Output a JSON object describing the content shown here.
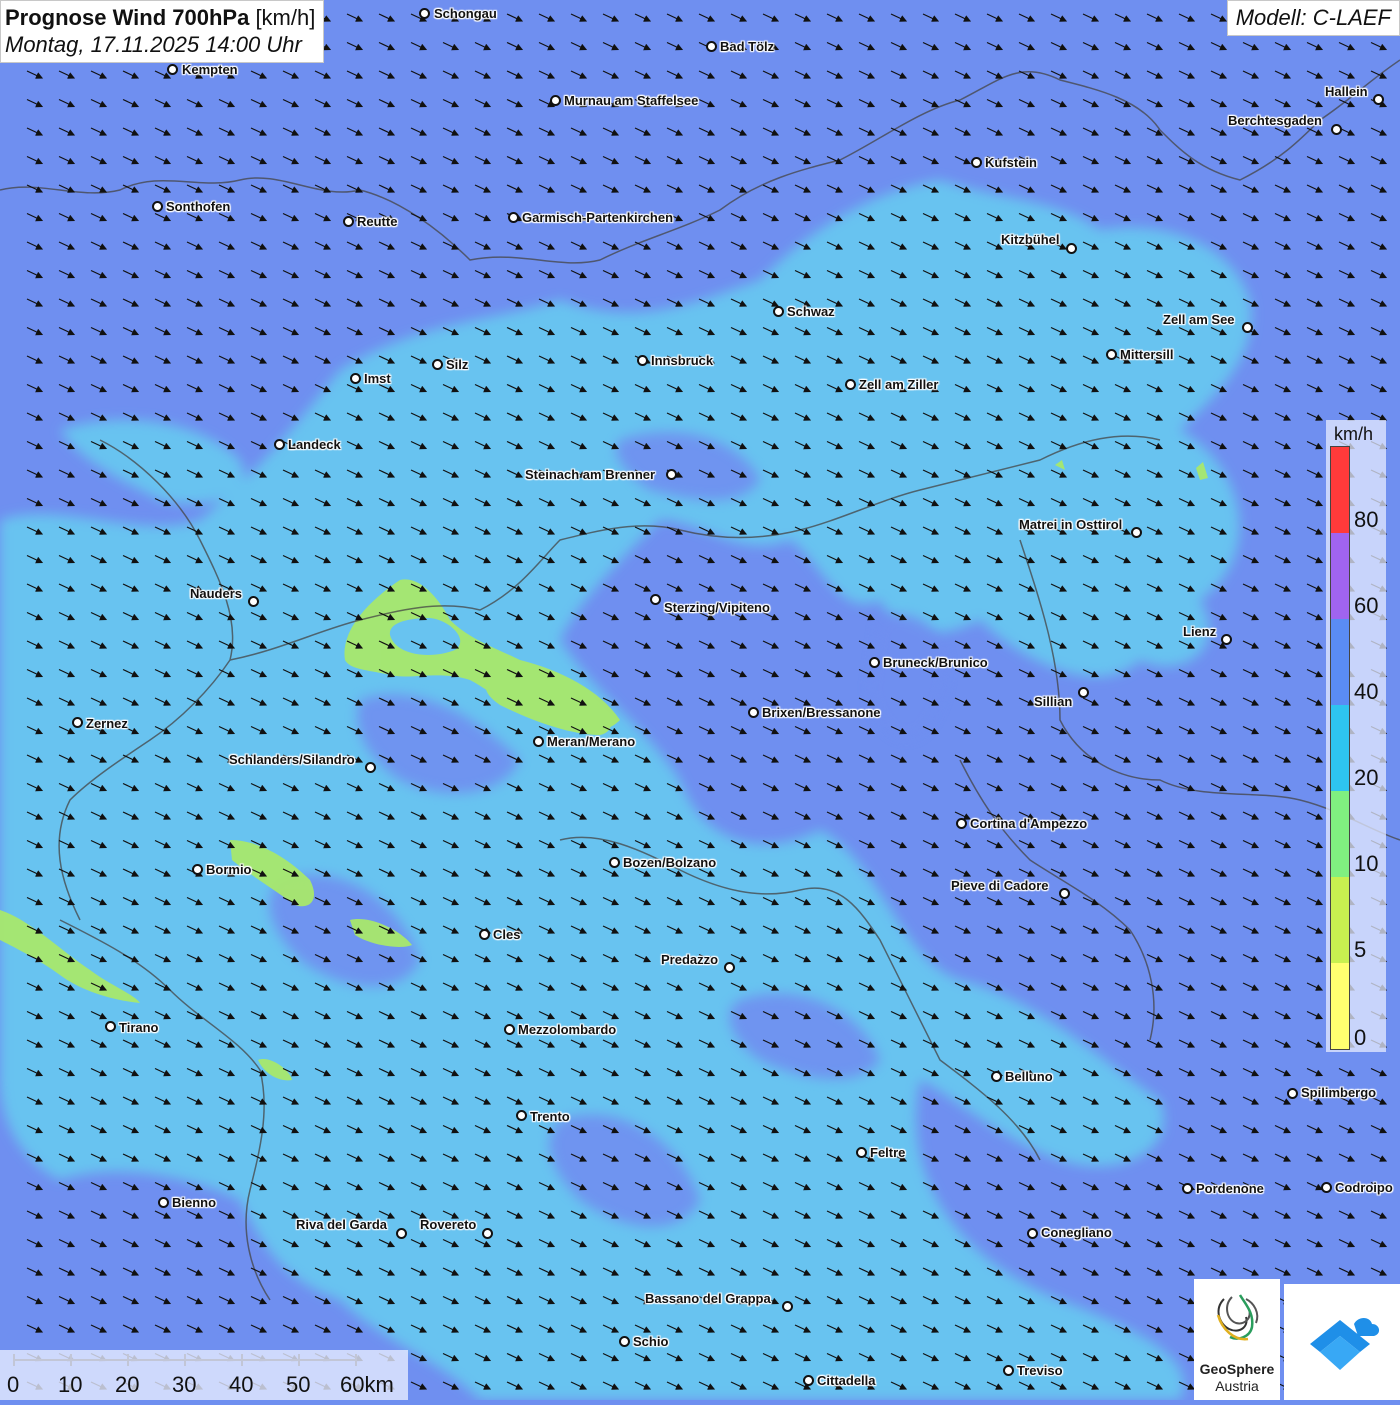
{
  "title": {
    "main": "Prognose Wind 700hPa",
    "unit": "[km/h]",
    "date": "Montag, 17.11.2025 14:00 Uhr"
  },
  "model": "Modell: C-LAEF",
  "legend": {
    "unit": "km/h",
    "labels": [
      "80",
      "60",
      "40",
      "20",
      "10",
      "5",
      "0"
    ],
    "colors": [
      "#ff3a3a",
      "#a064f0",
      "#5a8cf5",
      "#2ec4f0",
      "#80f080",
      "#c8f050",
      "#ffff70"
    ]
  },
  "scalebar": {
    "labels": [
      "0",
      "10",
      "20",
      "30",
      "40",
      "50",
      "60km"
    ]
  },
  "logo": {
    "line1": "GeoSphere",
    "line2": "Austria"
  },
  "colors": {
    "background": "#6f8ff0",
    "light_blue": "#6ec9f2",
    "green": "#a8e86c",
    "arrow": "#111111"
  },
  "cities": [
    {
      "name": "Schongau"
    },
    {
      "name": "Bad Tölz"
    },
    {
      "name": "Kempten"
    },
    {
      "name": "Murnau am Staffelsee"
    },
    {
      "name": "Hallein"
    },
    {
      "name": "Berchtesgaden"
    },
    {
      "name": "Kufstein"
    },
    {
      "name": "Sonthofen"
    },
    {
      "name": "Reutte"
    },
    {
      "name": "Garmisch-Partenkirchen"
    },
    {
      "name": "Kitzbühel"
    },
    {
      "name": "Schwaz"
    },
    {
      "name": "Zell am See"
    },
    {
      "name": "Mittersill"
    },
    {
      "name": "Imst"
    },
    {
      "name": "Silz"
    },
    {
      "name": "Innsbruck"
    },
    {
      "name": "Zell am Ziller"
    },
    {
      "name": "Landeck"
    },
    {
      "name": "Steinach am Brenner"
    },
    {
      "name": "Matrei in Osttirol"
    },
    {
      "name": "Nauders"
    },
    {
      "name": "Sterzing/Vipiteno"
    },
    {
      "name": "Lienz"
    },
    {
      "name": "Bruneck/Brunico"
    },
    {
      "name": "Sillian"
    },
    {
      "name": "Brixen/Bressanone"
    },
    {
      "name": "Zernez"
    },
    {
      "name": "Meran/Merano"
    },
    {
      "name": "Schlanders/Silandro"
    },
    {
      "name": "Cortina d'Ampezzo"
    },
    {
      "name": "Bozen/Bolzano"
    },
    {
      "name": "Bormio"
    },
    {
      "name": "Pieve di Cadore"
    },
    {
      "name": "Cles"
    },
    {
      "name": "Predazzo"
    },
    {
      "name": "Tirano"
    },
    {
      "name": "Mezzolombardo"
    },
    {
      "name": "Belluno"
    },
    {
      "name": "Spilimbergo"
    },
    {
      "name": "Trento"
    },
    {
      "name": "Feltre"
    },
    {
      "name": "Pordenone"
    },
    {
      "name": "Codroipo"
    },
    {
      "name": "Bienno"
    },
    {
      "name": "Riva del Garda"
    },
    {
      "name": "Rovereto"
    },
    {
      "name": "Conegliano"
    },
    {
      "name": "Bassano del Grappa"
    },
    {
      "name": "Schio"
    },
    {
      "name": "Treviso"
    },
    {
      "name": "Cittadella"
    }
  ]
}
